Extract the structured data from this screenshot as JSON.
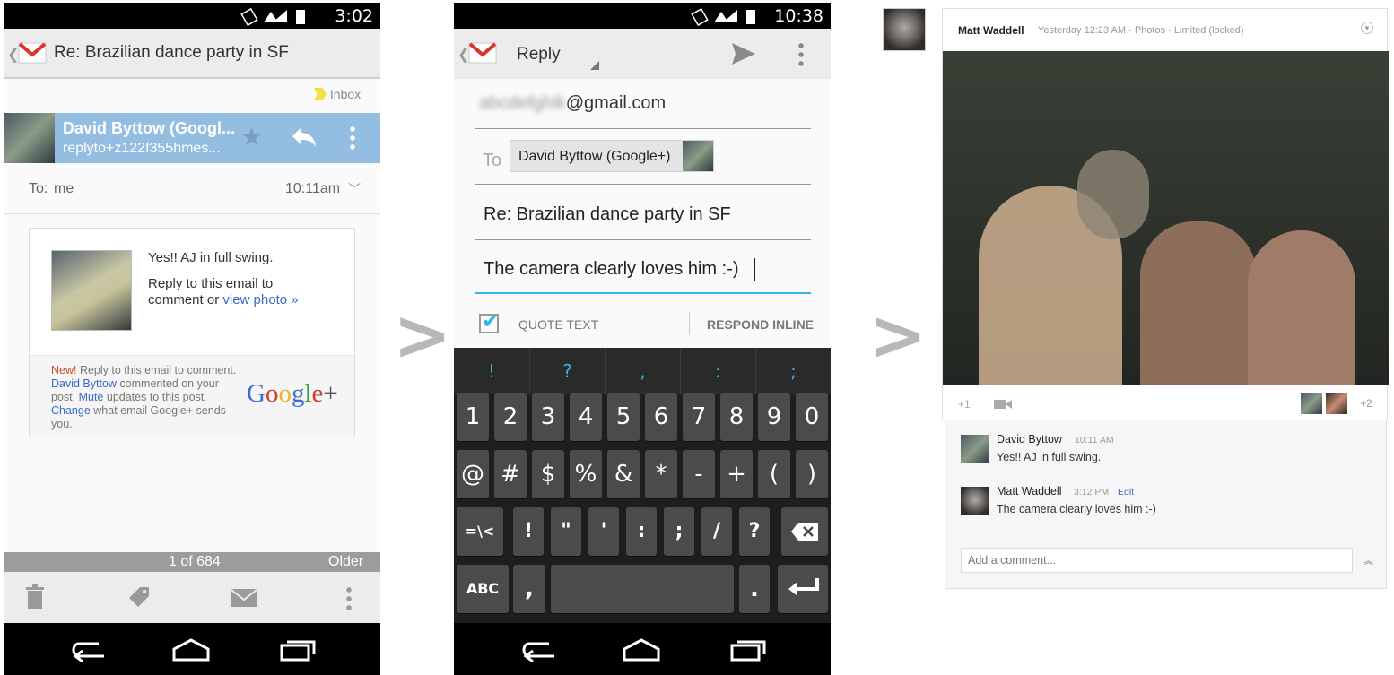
{
  "left_phone": {
    "time": "3:02",
    "subject": "Re: Brazilian dance party in SF",
    "label": "Inbox",
    "sender_name": "David Byttow (Googl...",
    "sender_email": "replyto+z122f355hmes...",
    "to_label": "To:",
    "to_value": "me",
    "sent_time": "10:11am",
    "body_line1": "Yes!! AJ in full swing.",
    "body_line2": "Reply to this email to",
    "body_line3": "comment or",
    "view_photo": "view photo »",
    "footer_new": "New!",
    "footer_t1": " Reply to this email to comment.",
    "footer_link1": "David Byttow",
    "footer_t2": " commented on your",
    "footer_t3": "post.",
    "footer_link2": "Mute",
    "footer_t4": " updates to this post.",
    "footer_link3": "Change",
    "footer_t5": " what email Google+ sends",
    "footer_t6": "you.",
    "gplus_logo": "Google+",
    "pager": "1 of 684",
    "older": "Older",
    "icons": [
      "trash-icon",
      "label-icon",
      "mark-unread-icon",
      "overflow-icon"
    ]
  },
  "middle_phone": {
    "time": "10:38",
    "title": "Reply",
    "from_blurred": "abcdefghik",
    "from_domain": "@gmail.com",
    "to_label": "To",
    "recipient": "David Byttow (Google+)",
    "subject": "Re: Brazilian dance party in SF",
    "body": "The camera clearly loves him :-)",
    "quote_text": "QUOTE TEXT",
    "respond_inline": "RESPOND INLINE",
    "suggestions": [
      "!",
      "?",
      ",",
      ":",
      ";"
    ],
    "row1": [
      "1",
      "2",
      "3",
      "4",
      "5",
      "6",
      "7",
      "8",
      "9",
      "0"
    ],
    "row2": [
      "@",
      "#",
      "$",
      "%",
      "&",
      "*",
      "-",
      "+",
      "(",
      ")"
    ],
    "row3": [
      "=\\<",
      "!",
      "\"",
      "'",
      ":",
      ";",
      "/",
      "?"
    ],
    "abc": "ABC",
    "comma": ",",
    "period": "."
  },
  "separator": ">",
  "post": {
    "author": "Matt Waddell",
    "meta1": "Yesterday 12:23 AM",
    "meta_dash": "-",
    "meta2": "Photos",
    "meta3": "Limited (locked)",
    "plus_one": "+1",
    "extra": "+2",
    "comments": [
      {
        "name": "David Byttow",
        "time": "10:11 AM",
        "edit": "",
        "text": "Yes!! AJ in full swing."
      },
      {
        "name": "Matt Waddell",
        "time": "3:12 PM",
        "edit": "Edit",
        "text": "The camera clearly loves him :-)"
      }
    ],
    "comment_placeholder": "Add a comment..."
  }
}
